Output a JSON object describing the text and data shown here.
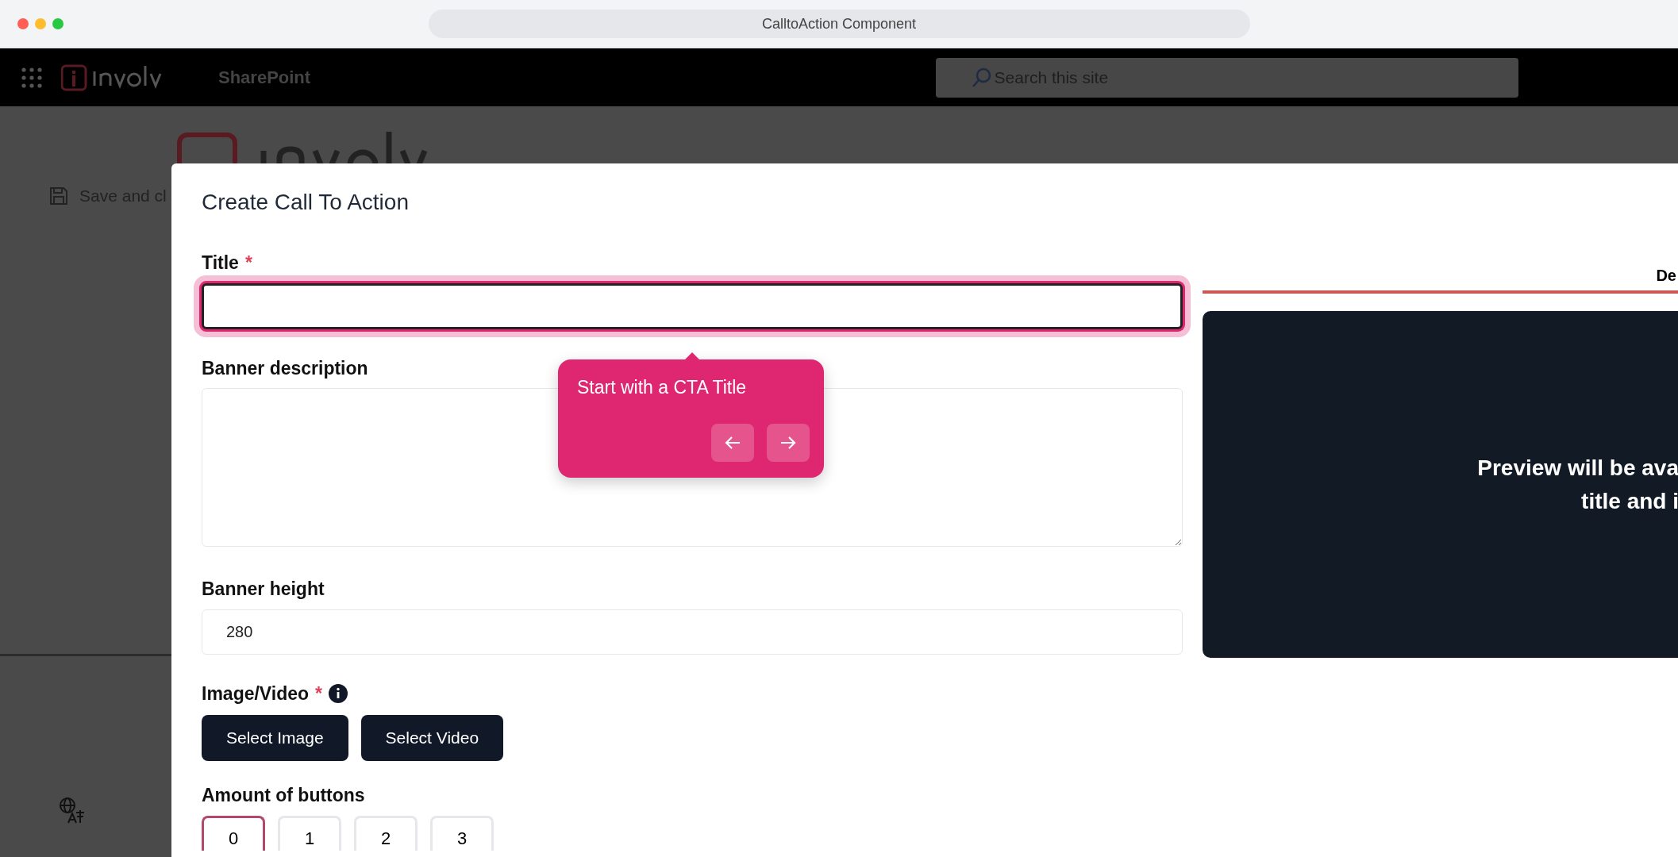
{
  "browser": {
    "title": "CalltoAction Component"
  },
  "suite_bar": {
    "app_name": "SharePoint",
    "search": {
      "placeholder": "Search this site"
    }
  },
  "page": {
    "command": "Save and cl"
  },
  "dialog": {
    "title": "Create Call To Action",
    "fields": [
      {
        "kind": "text",
        "label": "Title",
        "required_mark": "*",
        "focused": true
      },
      {
        "kind": "textarea",
        "label": "Banner description",
        "focused": false
      },
      {
        "kind": "text",
        "label": "Banner height",
        "focused": false,
        "value": "280"
      }
    ],
    "media": {
      "label": "Image/Video",
      "required_mark": "*",
      "buttons": [
        "Select Image",
        "Select Video"
      ]
    },
    "amount": {
      "label": "Amount of buttons",
      "options": [
        {
          "label": "0",
          "selected": true
        },
        {
          "label": "1",
          "selected": false
        },
        {
          "label": "2",
          "selected": false
        },
        {
          "label": "3",
          "selected": false
        }
      ]
    },
    "preview": {
      "tab": "De",
      "lines": [
        "Preview will be ava",
        "title and i"
      ]
    }
  },
  "tour": {
    "text": "Start with a CTA Title"
  }
}
